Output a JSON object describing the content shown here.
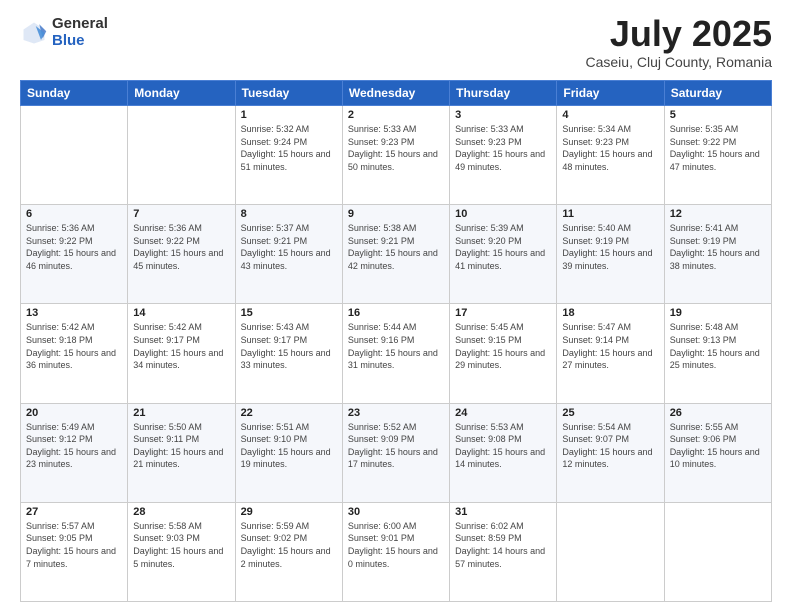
{
  "header": {
    "logo": {
      "general": "General",
      "blue": "Blue"
    },
    "title": "July 2025",
    "location": "Caseiu, Cluj County, Romania"
  },
  "weekdays": [
    "Sunday",
    "Monday",
    "Tuesday",
    "Wednesday",
    "Thursday",
    "Friday",
    "Saturday"
  ],
  "weeks": [
    [
      {
        "day": "",
        "sunrise": "",
        "sunset": "",
        "daylight": ""
      },
      {
        "day": "",
        "sunrise": "",
        "sunset": "",
        "daylight": ""
      },
      {
        "day": "1",
        "sunrise": "Sunrise: 5:32 AM",
        "sunset": "Sunset: 9:24 PM",
        "daylight": "Daylight: 15 hours and 51 minutes."
      },
      {
        "day": "2",
        "sunrise": "Sunrise: 5:33 AM",
        "sunset": "Sunset: 9:23 PM",
        "daylight": "Daylight: 15 hours and 50 minutes."
      },
      {
        "day": "3",
        "sunrise": "Sunrise: 5:33 AM",
        "sunset": "Sunset: 9:23 PM",
        "daylight": "Daylight: 15 hours and 49 minutes."
      },
      {
        "day": "4",
        "sunrise": "Sunrise: 5:34 AM",
        "sunset": "Sunset: 9:23 PM",
        "daylight": "Daylight: 15 hours and 48 minutes."
      },
      {
        "day": "5",
        "sunrise": "Sunrise: 5:35 AM",
        "sunset": "Sunset: 9:22 PM",
        "daylight": "Daylight: 15 hours and 47 minutes."
      }
    ],
    [
      {
        "day": "6",
        "sunrise": "Sunrise: 5:36 AM",
        "sunset": "Sunset: 9:22 PM",
        "daylight": "Daylight: 15 hours and 46 minutes."
      },
      {
        "day": "7",
        "sunrise": "Sunrise: 5:36 AM",
        "sunset": "Sunset: 9:22 PM",
        "daylight": "Daylight: 15 hours and 45 minutes."
      },
      {
        "day": "8",
        "sunrise": "Sunrise: 5:37 AM",
        "sunset": "Sunset: 9:21 PM",
        "daylight": "Daylight: 15 hours and 43 minutes."
      },
      {
        "day": "9",
        "sunrise": "Sunrise: 5:38 AM",
        "sunset": "Sunset: 9:21 PM",
        "daylight": "Daylight: 15 hours and 42 minutes."
      },
      {
        "day": "10",
        "sunrise": "Sunrise: 5:39 AM",
        "sunset": "Sunset: 9:20 PM",
        "daylight": "Daylight: 15 hours and 41 minutes."
      },
      {
        "day": "11",
        "sunrise": "Sunrise: 5:40 AM",
        "sunset": "Sunset: 9:19 PM",
        "daylight": "Daylight: 15 hours and 39 minutes."
      },
      {
        "day": "12",
        "sunrise": "Sunrise: 5:41 AM",
        "sunset": "Sunset: 9:19 PM",
        "daylight": "Daylight: 15 hours and 38 minutes."
      }
    ],
    [
      {
        "day": "13",
        "sunrise": "Sunrise: 5:42 AM",
        "sunset": "Sunset: 9:18 PM",
        "daylight": "Daylight: 15 hours and 36 minutes."
      },
      {
        "day": "14",
        "sunrise": "Sunrise: 5:42 AM",
        "sunset": "Sunset: 9:17 PM",
        "daylight": "Daylight: 15 hours and 34 minutes."
      },
      {
        "day": "15",
        "sunrise": "Sunrise: 5:43 AM",
        "sunset": "Sunset: 9:17 PM",
        "daylight": "Daylight: 15 hours and 33 minutes."
      },
      {
        "day": "16",
        "sunrise": "Sunrise: 5:44 AM",
        "sunset": "Sunset: 9:16 PM",
        "daylight": "Daylight: 15 hours and 31 minutes."
      },
      {
        "day": "17",
        "sunrise": "Sunrise: 5:45 AM",
        "sunset": "Sunset: 9:15 PM",
        "daylight": "Daylight: 15 hours and 29 minutes."
      },
      {
        "day": "18",
        "sunrise": "Sunrise: 5:47 AM",
        "sunset": "Sunset: 9:14 PM",
        "daylight": "Daylight: 15 hours and 27 minutes."
      },
      {
        "day": "19",
        "sunrise": "Sunrise: 5:48 AM",
        "sunset": "Sunset: 9:13 PM",
        "daylight": "Daylight: 15 hours and 25 minutes."
      }
    ],
    [
      {
        "day": "20",
        "sunrise": "Sunrise: 5:49 AM",
        "sunset": "Sunset: 9:12 PM",
        "daylight": "Daylight: 15 hours and 23 minutes."
      },
      {
        "day": "21",
        "sunrise": "Sunrise: 5:50 AM",
        "sunset": "Sunset: 9:11 PM",
        "daylight": "Daylight: 15 hours and 21 minutes."
      },
      {
        "day": "22",
        "sunrise": "Sunrise: 5:51 AM",
        "sunset": "Sunset: 9:10 PM",
        "daylight": "Daylight: 15 hours and 19 minutes."
      },
      {
        "day": "23",
        "sunrise": "Sunrise: 5:52 AM",
        "sunset": "Sunset: 9:09 PM",
        "daylight": "Daylight: 15 hours and 17 minutes."
      },
      {
        "day": "24",
        "sunrise": "Sunrise: 5:53 AM",
        "sunset": "Sunset: 9:08 PM",
        "daylight": "Daylight: 15 hours and 14 minutes."
      },
      {
        "day": "25",
        "sunrise": "Sunrise: 5:54 AM",
        "sunset": "Sunset: 9:07 PM",
        "daylight": "Daylight: 15 hours and 12 minutes."
      },
      {
        "day": "26",
        "sunrise": "Sunrise: 5:55 AM",
        "sunset": "Sunset: 9:06 PM",
        "daylight": "Daylight: 15 hours and 10 minutes."
      }
    ],
    [
      {
        "day": "27",
        "sunrise": "Sunrise: 5:57 AM",
        "sunset": "Sunset: 9:05 PM",
        "daylight": "Daylight: 15 hours and 7 minutes."
      },
      {
        "day": "28",
        "sunrise": "Sunrise: 5:58 AM",
        "sunset": "Sunset: 9:03 PM",
        "daylight": "Daylight: 15 hours and 5 minutes."
      },
      {
        "day": "29",
        "sunrise": "Sunrise: 5:59 AM",
        "sunset": "Sunset: 9:02 PM",
        "daylight": "Daylight: 15 hours and 2 minutes."
      },
      {
        "day": "30",
        "sunrise": "Sunrise: 6:00 AM",
        "sunset": "Sunset: 9:01 PM",
        "daylight": "Daylight: 15 hours and 0 minutes."
      },
      {
        "day": "31",
        "sunrise": "Sunrise: 6:02 AM",
        "sunset": "Sunset: 8:59 PM",
        "daylight": "Daylight: 14 hours and 57 minutes."
      },
      {
        "day": "",
        "sunrise": "",
        "sunset": "",
        "daylight": ""
      },
      {
        "day": "",
        "sunrise": "",
        "sunset": "",
        "daylight": ""
      }
    ]
  ]
}
